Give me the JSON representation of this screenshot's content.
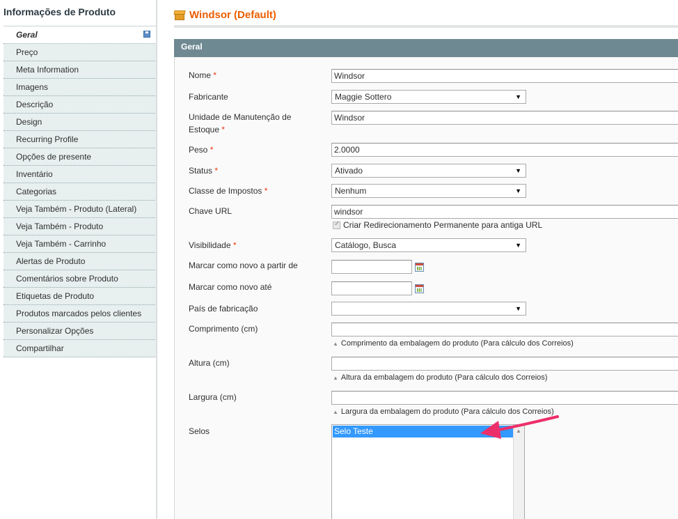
{
  "sidebar": {
    "title": "Informações de Produto",
    "items": [
      {
        "label": "Geral",
        "active": true
      },
      {
        "label": "Preço"
      },
      {
        "label": "Meta Information"
      },
      {
        "label": "Imagens"
      },
      {
        "label": "Descrição"
      },
      {
        "label": "Design"
      },
      {
        "label": "Recurring Profile"
      },
      {
        "label": "Opções de presente"
      },
      {
        "label": "Inventário"
      },
      {
        "label": "Categorias"
      },
      {
        "label": "Veja Também - Produto (Lateral)"
      },
      {
        "label": "Veja Também - Produto"
      },
      {
        "label": "Veja Também - Carrinho"
      },
      {
        "label": "Alertas de Produto"
      },
      {
        "label": "Comentários sobre Produto"
      },
      {
        "label": "Etiquetas de Produto"
      },
      {
        "label": "Produtos marcados pelos clientes"
      },
      {
        "label": "Personalizar Opções"
      },
      {
        "label": "Compartilhar"
      }
    ]
  },
  "header": {
    "title": "Windsor (Default)",
    "icon": "product-box-icon"
  },
  "section": {
    "title": "Geral"
  },
  "form": {
    "required_mark": "*",
    "nome": {
      "label": "Nome",
      "value": "Windsor"
    },
    "fabricante": {
      "label": "Fabricante",
      "value": "Maggie Sottero"
    },
    "sku": {
      "label_line1": "Unidade de Manutenção de",
      "label_line2": "Estoque",
      "value": "Windsor"
    },
    "peso": {
      "label": "Peso",
      "value": "2.0000"
    },
    "status": {
      "label": "Status",
      "value": "Ativado"
    },
    "classe": {
      "label": "Classe de Impostos",
      "value": "Nenhum"
    },
    "url": {
      "label": "Chave URL",
      "value": "windsor",
      "checkbox_label": "Criar Redirecionamento Permanente para antiga URL"
    },
    "visibilidade": {
      "label": "Visibilidade",
      "value": "Catálogo, Busca"
    },
    "novo_de": {
      "label": "Marcar como novo a partir de",
      "value": ""
    },
    "novo_ate": {
      "label": "Marcar como novo até",
      "value": ""
    },
    "pais": {
      "label": "País de fabricação",
      "value": ""
    },
    "comprimento": {
      "label": "Comprimento (cm)",
      "value": "",
      "note": "Comprimento da embalagem do produto (Para cálculo dos Correios)"
    },
    "altura": {
      "label": "Altura (cm)",
      "value": "",
      "note": "Altura da embalagem do produto (Para cálculo dos Correios)"
    },
    "largura": {
      "label": "Largura (cm)",
      "value": "",
      "note": "Largura da embalagem do produto (Para cálculo dos Correios)"
    },
    "selos": {
      "label": "Selos",
      "options": [
        "Selo Teste"
      ]
    }
  },
  "colors": {
    "accent_title": "#eb5e00",
    "section_header": "#6f8992",
    "selected_option": "#3399ff",
    "annotation_arrow": "#ec2f6a",
    "required": "#eb340a"
  }
}
